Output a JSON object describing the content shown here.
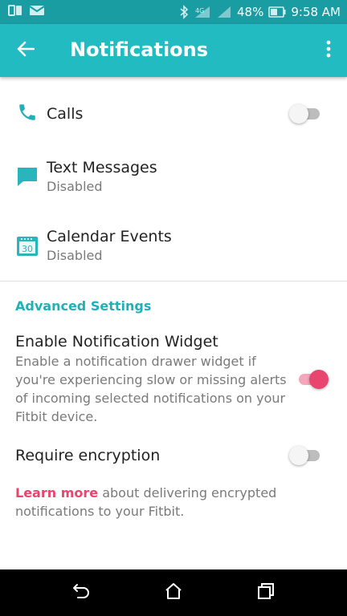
{
  "status_bar": {
    "battery": "48%",
    "time": "9:58 AM",
    "icons": [
      "screen-mirror-icon",
      "mail-icon",
      "bluetooth-icon",
      "lte-icon",
      "signal-icon",
      "battery-icon"
    ]
  },
  "app_bar": {
    "title": "Notifications",
    "back_icon": "back-arrow-icon",
    "menu_icon": "more-vert-icon"
  },
  "notifications": [
    {
      "title": "Calls",
      "subtitle": "",
      "icon": "phone-icon",
      "enabled": false
    },
    {
      "title": "Text Messages",
      "subtitle": "Disabled",
      "icon": "message-icon"
    },
    {
      "title": "Calendar Events",
      "subtitle": "Disabled",
      "icon": "calendar-icon",
      "icon_text": "30"
    }
  ],
  "advanced": {
    "header": "Advanced Settings",
    "widget": {
      "title": "Enable Notification Widget",
      "description": "Enable a notification drawer widget if you're experiencing slow or missing alerts of incoming selected notifications on your Fitbit device.",
      "enabled": true
    },
    "encryption": {
      "title": "Require encryption",
      "enabled": false
    },
    "learn_more": {
      "link_text": "Learn more",
      "rest": " about delivering encrypted notifications to your Fitbit."
    }
  },
  "nav_bar": {
    "icons": [
      "nav-back-icon",
      "nav-home-icon",
      "nav-recents-icon"
    ]
  },
  "colors": {
    "status_bar": "#1a9ca3",
    "app_bar": "#22bbc2",
    "accent_teal": "#1fb0b8",
    "accent_pink": "#e8466f"
  }
}
